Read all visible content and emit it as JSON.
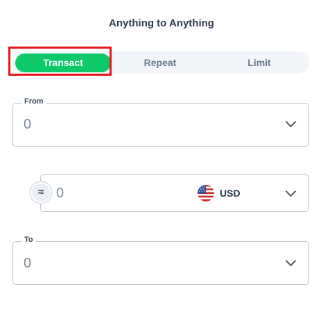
{
  "header": {
    "title": "Anything to Anything"
  },
  "tabs": [
    {
      "label": "Transact",
      "active": true
    },
    {
      "label": "Repeat",
      "active": false
    },
    {
      "label": "Limit",
      "active": false
    }
  ],
  "from": {
    "label": "From",
    "value": "0"
  },
  "conversion": {
    "approx_symbol": "≈",
    "value": "0",
    "currency": "USD",
    "currency_icon": "us-flag-icon"
  },
  "to": {
    "label": "To",
    "value": "0"
  },
  "colors": {
    "accent": "#0ec96a",
    "highlight": "#e8141c"
  }
}
